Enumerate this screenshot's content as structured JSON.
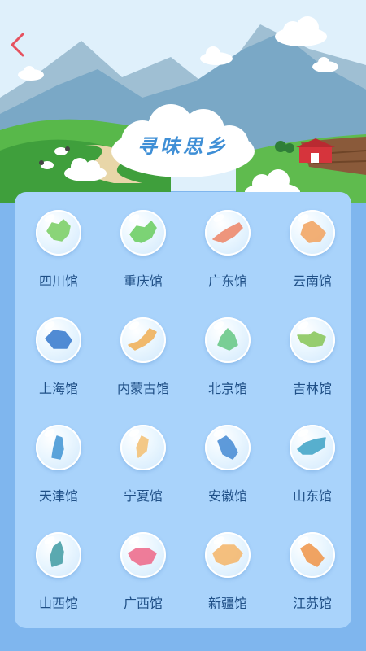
{
  "header": {
    "back_icon": "chevron-left-icon",
    "title": "寻味思乡"
  },
  "colors": {
    "sky": "#dff0fb",
    "panel": "#a9d3fb",
    "background": "#7fb6ee",
    "title": "#3f8fd6",
    "label": "#1f4f86",
    "back_arrow": "#e6525f"
  },
  "provinces": [
    {
      "label": "四川馆",
      "color": "#7fd06a"
    },
    {
      "label": "重庆馆",
      "color": "#6fcf66"
    },
    {
      "label": "广东馆",
      "color": "#ee8a6e"
    },
    {
      "label": "云南馆",
      "color": "#f2a766"
    },
    {
      "label": "上海馆",
      "color": "#3f7fd0"
    },
    {
      "label": "内蒙古馆",
      "color": "#f0b25e"
    },
    {
      "label": "北京馆",
      "color": "#6cc98a"
    },
    {
      "label": "吉林馆",
      "color": "#8cc860"
    },
    {
      "label": "天津馆",
      "color": "#4a9ad6"
    },
    {
      "label": "宁夏馆",
      "color": "#f3c27a"
    },
    {
      "label": "安徽馆",
      "color": "#4d8fd6"
    },
    {
      "label": "山东馆",
      "color": "#46a7c9"
    },
    {
      "label": "山西馆",
      "color": "#4aa0a8"
    },
    {
      "label": "广西馆",
      "color": "#ee6e8e"
    },
    {
      "label": "新疆馆",
      "color": "#f4b870"
    },
    {
      "label": "江苏馆",
      "color": "#f09a52"
    }
  ]
}
